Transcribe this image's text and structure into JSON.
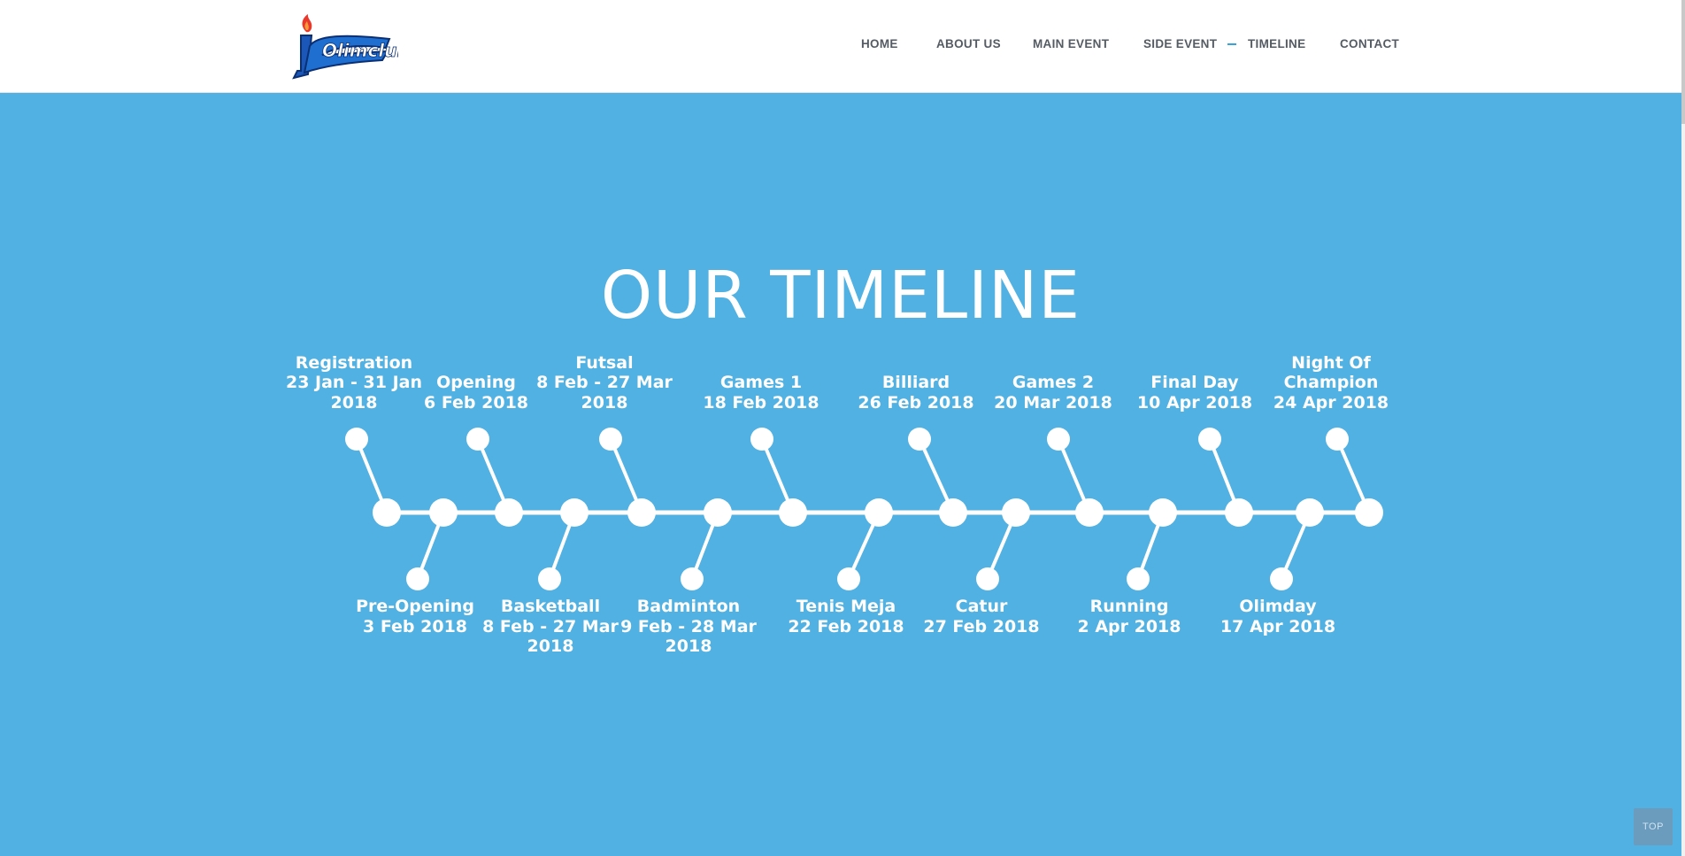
{
  "nav": {
    "items": [
      {
        "label": "HOME"
      },
      {
        "label": "ABOUT US"
      },
      {
        "label": "MAIN EVENT"
      },
      {
        "label": "SIDE EVENT"
      },
      {
        "label": "TIMELINE",
        "active": true
      },
      {
        "label": "CONTACT"
      }
    ]
  },
  "logo": {
    "text": "Olimclub",
    "icon": "torch-logo-icon"
  },
  "title": "OUR TIMELINE",
  "timeline": {
    "above": [
      {
        "name": "Registration",
        "date_lines": [
          "23 Jan - 31 Jan",
          "2018"
        ]
      },
      {
        "name": "Opening",
        "date_lines": [
          "6 Feb 2018"
        ]
      },
      {
        "name": "Futsal",
        "date_lines": [
          "8 Feb - 27 Mar",
          "2018"
        ]
      },
      {
        "name": "Games 1",
        "date_lines": [
          "18 Feb 2018"
        ]
      },
      {
        "name": "Billiard",
        "date_lines": [
          "26 Feb 2018"
        ]
      },
      {
        "name": "Games 2",
        "date_lines": [
          "20 Mar 2018"
        ]
      },
      {
        "name": "Final Day",
        "date_lines": [
          "10 Apr 2018"
        ]
      },
      {
        "name": "Night Of Champion",
        "name_lines": [
          "Night Of",
          "Champion"
        ],
        "date_lines": [
          "24 Apr 2018"
        ]
      }
    ],
    "below": [
      {
        "name": "Pre-Opening",
        "date_lines": [
          "3 Feb 2018"
        ]
      },
      {
        "name": "Basketball",
        "date_lines": [
          "8 Feb - 27 Mar",
          "2018"
        ]
      },
      {
        "name": "Badminton",
        "date_lines": [
          "9 Feb - 28 Mar",
          "2018"
        ]
      },
      {
        "name": "Tenis Meja",
        "date_lines": [
          "22 Feb 2018"
        ]
      },
      {
        "name": "Catur",
        "date_lines": [
          "27 Feb 2018"
        ]
      },
      {
        "name": "Running",
        "date_lines": [
          "2 Apr 2018"
        ]
      },
      {
        "name": "Olimday",
        "date_lines": [
          "17 Apr 2018"
        ]
      }
    ]
  },
  "top_button": {
    "label": "TOP"
  },
  "colors": {
    "background": "#50b1e2",
    "header": "#ffffff",
    "nav_text": "#555b63",
    "accent": "#37a3dc",
    "timeline": "#ffffff"
  }
}
